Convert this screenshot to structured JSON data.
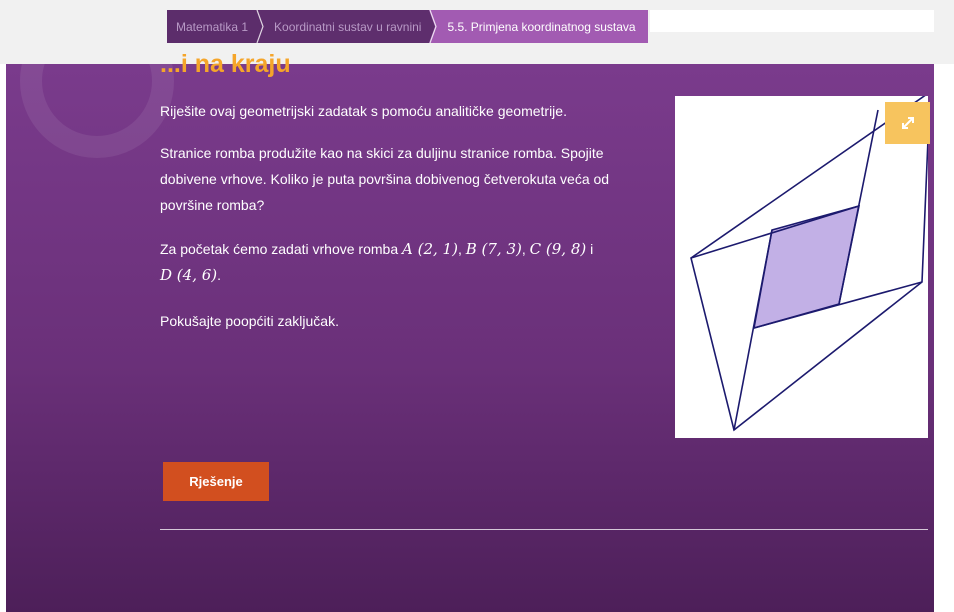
{
  "breadcrumb": {
    "items": [
      {
        "label": "Matematika 1"
      },
      {
        "label": "Koordinatni sustav u ravnini"
      },
      {
        "label": "5.5. Primjena koordinatnog sustava"
      }
    ]
  },
  "section": {
    "title": "...i na kraju",
    "intro": "Riješite ovaj geometrijski zadatak s pomoću analitičke geometrije.",
    "task": "Stranice romba produžite kao na skici za duljinu stranice romba. Spojite dobivene vrhove. Koliko je puta površina dobivenog četverokuta veća od površine romba?",
    "vertices_prefix": "Za početak ćemo zadati vrhove romba",
    "vertex_a": "A (2, 1)",
    "vertex_b": "B (7, 3)",
    "vertex_c": "C (9, 8)",
    "vertex_d": "D (4, 6)",
    "conj": "i",
    "closing": "Pokušajte poopćiti zaključak."
  },
  "figure": {
    "expand_icon": "expand-icon",
    "fill_color": "#c2b0e6",
    "stroke_color": "#1c1a6e"
  },
  "solution_button": {
    "label": "Rješenje"
  },
  "colors": {
    "accent_heading": "#f5a52a",
    "button": "#d24f1f",
    "background": "#6a3079"
  }
}
